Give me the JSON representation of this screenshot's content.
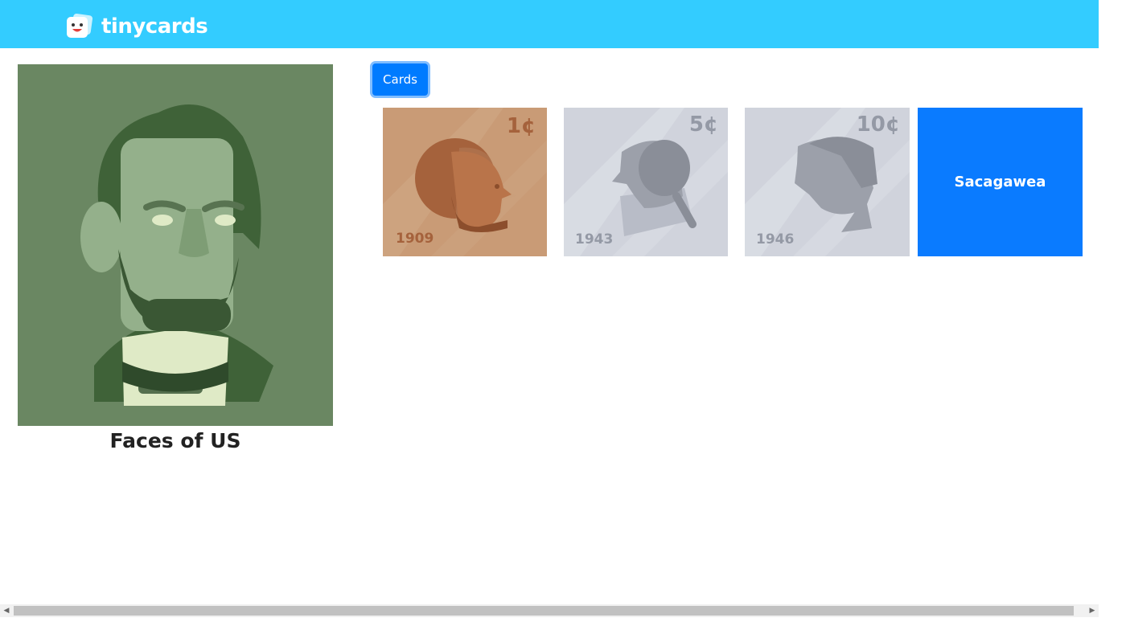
{
  "header": {
    "brand": "tinycards",
    "bg_color": "#33ccff"
  },
  "deck": {
    "title": "Faces of US",
    "cover_icon": "lincoln-portrait-icon"
  },
  "tabs": {
    "cards_label": "Cards",
    "accent": "#007bff"
  },
  "cards": [
    {
      "denomination": "1¢",
      "year": "1909",
      "color": "#c99b76"
    },
    {
      "denomination": "5¢",
      "year": "1943",
      "color": "#d0d3dc"
    },
    {
      "denomination": "10¢",
      "year": "1946",
      "color": "#d0d3dc"
    },
    {
      "label": "Sacagawea",
      "color": "#0a7bff"
    }
  ]
}
